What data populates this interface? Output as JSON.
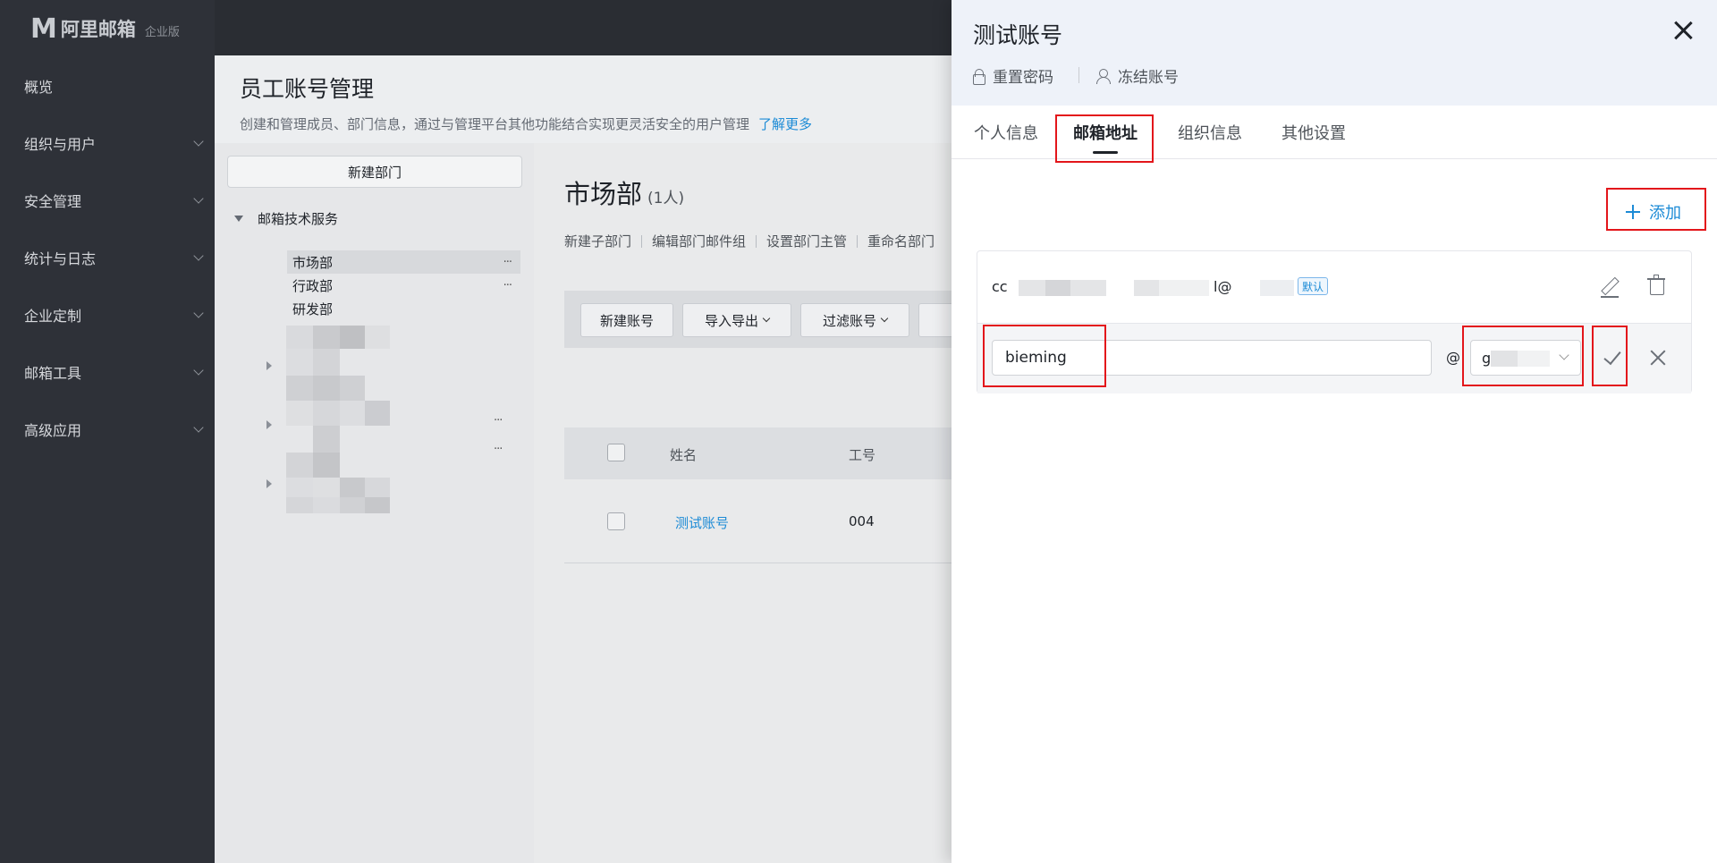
{
  "brand": {
    "logo_mark": "M",
    "name": "阿里邮箱",
    "edition": "企业版"
  },
  "sidebar": {
    "items": [
      {
        "label": "概览"
      },
      {
        "label": "组织与用户"
      },
      {
        "label": "安全管理"
      },
      {
        "label": "统计与日志"
      },
      {
        "label": "企业定制"
      },
      {
        "label": "邮箱工具"
      },
      {
        "label": "高级应用"
      }
    ]
  },
  "page": {
    "title": "员工账号管理",
    "description": "创建和管理成员、部门信息，通过与管理平台其他功能结合实现更灵活安全的用户管理",
    "learn_more": "了解更多"
  },
  "tree": {
    "new_dept_label": "新建部门",
    "root": "邮箱技术服务",
    "nodes": [
      {
        "label": "市场部",
        "more": "···"
      },
      {
        "label": "行政部",
        "more": "···"
      },
      {
        "label": "研发部"
      }
    ],
    "extra_more": [
      "···",
      "···"
    ]
  },
  "department": {
    "name": "市场部",
    "count": "(1人)",
    "actions": [
      "新建子部门",
      "编辑部门邮件组",
      "设置部门主管",
      "重命名部门"
    ]
  },
  "toolbar": {
    "new_account": "新建账号",
    "import_export": "导入导出",
    "filter": "过滤账号"
  },
  "table": {
    "headers": {
      "name": "姓名",
      "id": "工号"
    },
    "rows": [
      {
        "name": "测试账号",
        "id": "004"
      }
    ]
  },
  "drawer": {
    "title": "测试账号",
    "reset_password": "重置密码",
    "freeze_account": "冻结账号",
    "tabs": [
      {
        "label": "个人信息"
      },
      {
        "label": "邮箱地址"
      },
      {
        "label": "组织信息"
      },
      {
        "label": "其他设置"
      }
    ],
    "active_tab": "邮箱地址",
    "add_label": "添加",
    "addresses": [
      {
        "prefix": "cc",
        "at": "l@",
        "badge": "默认"
      }
    ],
    "edit": {
      "value": "bieming",
      "at": "@",
      "domain_value": "g"
    }
  },
  "colors": {
    "accent": "#1c8bd6",
    "highlight": "#e3161b",
    "sidebar": "#2e3138"
  },
  "icons": [
    "lock-icon",
    "user-icon",
    "close-icon",
    "plus-icon",
    "edit-icon",
    "trash-icon",
    "check-icon",
    "x-icon",
    "chevron-down-icon"
  ]
}
